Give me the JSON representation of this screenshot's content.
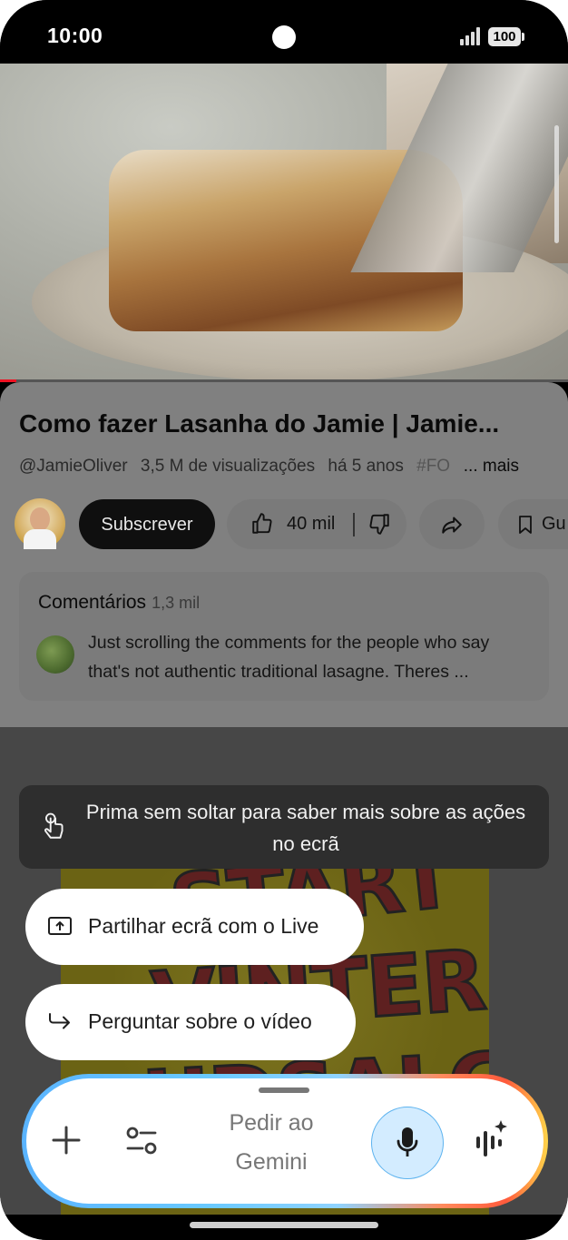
{
  "status_bar": {
    "time": "10:00",
    "battery": "100"
  },
  "video": {
    "title": "Como fazer Lasanha do Jamie | Jamie...",
    "channel": "@JamieOliver",
    "views": "3,5 M de visualizações",
    "age": "há 5 anos",
    "hashtag": "#FO",
    "more_label": "... mais"
  },
  "actions": {
    "subscribe_label": "Subscrever",
    "like_count": "40 mil",
    "save_label": "Gu"
  },
  "comments": {
    "heading": "Comentários",
    "count": "1,3 mil",
    "top_comment": "Just scrolling the comments for the people who say that's not authentic traditional lasagne. Theres ..."
  },
  "thumbnail_text": [
    "START",
    "VINTER",
    "UDSALG!"
  ],
  "tooltip": {
    "text": "Prima sem soltar para saber mais sobre as ações no ecrã"
  },
  "chips": [
    {
      "label": "Partilhar ecrã com o Live",
      "icon": "screen-share-icon"
    },
    {
      "label": "Perguntar sobre o vídeo",
      "icon": "forward-arrow-icon"
    }
  ],
  "gemini": {
    "placeholder": "Pedir ao Gemini"
  },
  "colors": {
    "subscribe_bg": "#0f0f0f",
    "mic_bg": "#d3ecff",
    "mic_border": "#5db3ef",
    "tooltip_bg": "#2e2e2e"
  }
}
